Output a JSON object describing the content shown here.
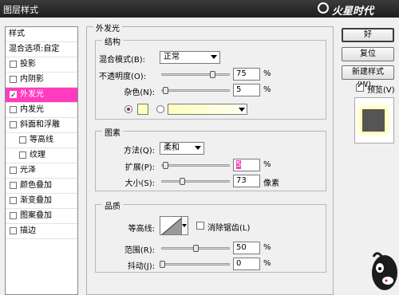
{
  "window": {
    "title": "图层样式"
  },
  "logo": {
    "text": "火星时代"
  },
  "sidebar": {
    "header": "样式",
    "items": [
      {
        "label": "混合选项:自定",
        "checkbox": false,
        "selected": false
      },
      {
        "label": "投影",
        "checkbox": true,
        "checked": false
      },
      {
        "label": "内阴影",
        "checkbox": true,
        "checked": false
      },
      {
        "label": "外发光",
        "checkbox": true,
        "checked": true,
        "selected": true
      },
      {
        "label": "内发光",
        "checkbox": true,
        "checked": false
      },
      {
        "label": "斜面和浮雕",
        "checkbox": true,
        "checked": false
      },
      {
        "label": "等高线",
        "checkbox": true,
        "checked": false,
        "sub": true
      },
      {
        "label": "纹理",
        "checkbox": true,
        "checked": false,
        "sub": true
      },
      {
        "label": "光泽",
        "checkbox": true,
        "checked": false
      },
      {
        "label": "颜色叠加",
        "checkbox": true,
        "checked": false
      },
      {
        "label": "渐变叠加",
        "checkbox": true,
        "checked": false
      },
      {
        "label": "图案叠加",
        "checkbox": true,
        "checked": false
      },
      {
        "label": "描边",
        "checkbox": true,
        "checked": false
      }
    ]
  },
  "panel": {
    "title": "外发光",
    "structure": {
      "title": "结构",
      "blend_mode_label": "混合模式(B):",
      "blend_mode_value": "正常",
      "opacity_label": "不透明度(O):",
      "opacity_value": "75",
      "opacity_level": 75,
      "noise_label": "杂色(N):",
      "noise_value": "5",
      "noise_level": 5,
      "percent": "%",
      "color_swatch": "#ffffbe"
    },
    "elements": {
      "title": "图素",
      "method_label": "方法(Q):",
      "method_value": "柔和",
      "spread_label": "扩展(P):",
      "spread_value": "5",
      "spread_level": 5,
      "size_label": "大小(S):",
      "size_value": "73",
      "size_level": 29.2,
      "percent": "%",
      "pixels": "像素"
    },
    "quality": {
      "title": "品质",
      "contour_label": "等高线:",
      "antialias_label": "消除锯齿(L)",
      "range_label": "范围(R):",
      "range_value": "50",
      "range_level": 50,
      "jitter_label": "抖动(J):",
      "jitter_value": "0",
      "jitter_level": 0,
      "percent": "%"
    }
  },
  "buttons": {
    "ok": "好",
    "reset": "复位",
    "new_style": "新建样式(W)...",
    "preview_label": "预览(V)",
    "preview_checked": true
  }
}
